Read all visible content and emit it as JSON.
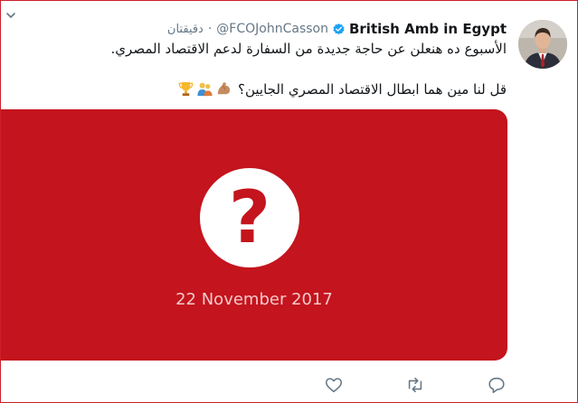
{
  "tweet": {
    "author_name": "British Amb in Egypt",
    "handle": "@FCOJohnCasson",
    "separator": "·",
    "timestamp": "دقيقتان",
    "text_line1": "الأسبوع ده هنعلن عن حاجة جديدة من السفارة لدعم الاقتصاد المصري.",
    "text_line2": "قل لنا مين هما ابطال الاقتصاد المصري الجايين؟",
    "emojis": [
      "flexed-biceps-icon",
      "people-icon",
      "trophy-icon"
    ],
    "media": {
      "caption_date": "22 November 2017",
      "symbol": "?",
      "background_color": "#c4141d"
    },
    "actions": [
      "reply-icon",
      "retweet-icon",
      "like-icon"
    ]
  },
  "colors": {
    "text": "#14171a",
    "muted": "#657786",
    "verified": "#1da1f2",
    "frame_border": "#cc1f2a"
  }
}
